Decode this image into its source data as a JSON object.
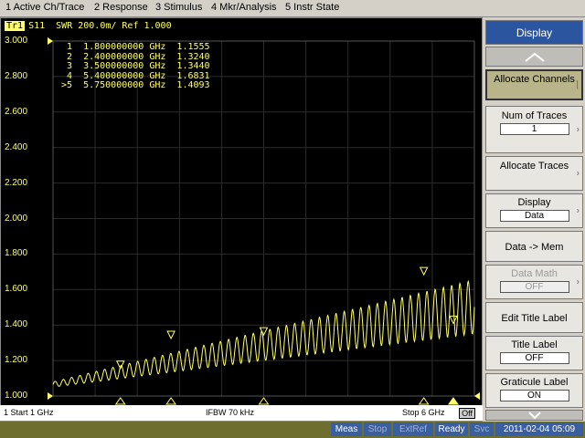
{
  "menu": [
    "1 Active Ch/Trace",
    "2 Response",
    "3 Stimulus",
    "4 Mkr/Analysis",
    "5 Instr State"
  ],
  "trace": {
    "id": "Tr1",
    "label": "S11  SWR 200.0m/ Ref 1.000"
  },
  "markers": [
    {
      "num": "1",
      "freq": "1.800000000 GHz",
      "val": "1.1555"
    },
    {
      "num": "2",
      "freq": "2.400000000 GHz",
      "val": "1.3240"
    },
    {
      "num": "3",
      "freq": "3.500000000 GHz",
      "val": "1.3440"
    },
    {
      "num": "4",
      "freq": "5.400000000 GHz",
      "val": "1.6831"
    },
    {
      "num": ">5",
      "freq": "5.750000000 GHz",
      "val": "1.4093"
    }
  ],
  "y_ticks": [
    "3.000",
    "2.800",
    "2.600",
    "2.400",
    "2.200",
    "2.000",
    "1.800",
    "1.600",
    "1.400",
    "1.200",
    "1.000"
  ],
  "status": {
    "start": "1  Start 1 GHz",
    "ifbw": "IFBW 70 kHz",
    "stop": "Stop 6 GHz",
    "off": "Off"
  },
  "bottombar": {
    "meas": "Meas",
    "stop": "Stop",
    "extref": "ExtRef",
    "ready": "Ready",
    "svc": "Svc",
    "datetime": "2011-02-04 05:09"
  },
  "softkeys": {
    "title": "Display",
    "allocate_channels": "Allocate Channels",
    "num_traces": "Num of Traces",
    "num_traces_val": "1",
    "allocate_traces": "Allocate Traces",
    "display": "Display",
    "display_val": "Data",
    "data_mem": "Data -> Mem",
    "data_math": "Data Math",
    "data_math_val": "OFF",
    "edit_title": "Edit Title Label",
    "title_label": "Title Label",
    "title_label_val": "OFF",
    "graticule_label": "Graticule Label",
    "graticule_label_val": "ON"
  },
  "chart_data": {
    "type": "line",
    "x_range_ghz": [
      1,
      6
    ],
    "ylim": [
      1.0,
      3.0
    ],
    "grid": true,
    "color": "#ffff66",
    "markers_ghz": [
      1.8,
      2.4,
      3.5,
      5.4,
      5.75
    ],
    "marker_values": [
      1.1555,
      1.324,
      1.344,
      1.6831,
      1.4093
    ]
  }
}
